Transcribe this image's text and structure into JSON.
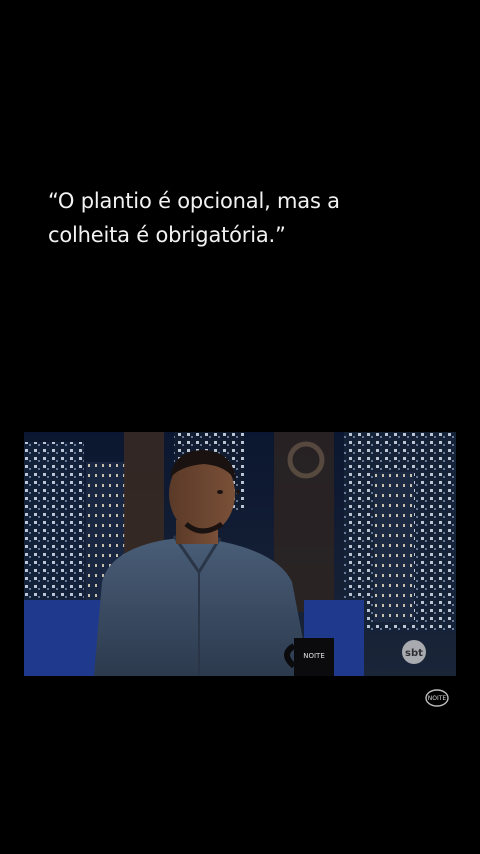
{
  "quote": {
    "line1": "“O plantio é opcional, mas a",
    "line2": "colheita é obrigatória.”"
  },
  "video": {
    "channel_bug": "sbt",
    "mug_logo": "NOITE"
  },
  "watermark": {
    "logo": "NOITE"
  },
  "colors": {
    "background": "#000000",
    "quote_text": "#f2f2f2",
    "shirt": "#3d5068",
    "couch": "#1f3a8c"
  }
}
